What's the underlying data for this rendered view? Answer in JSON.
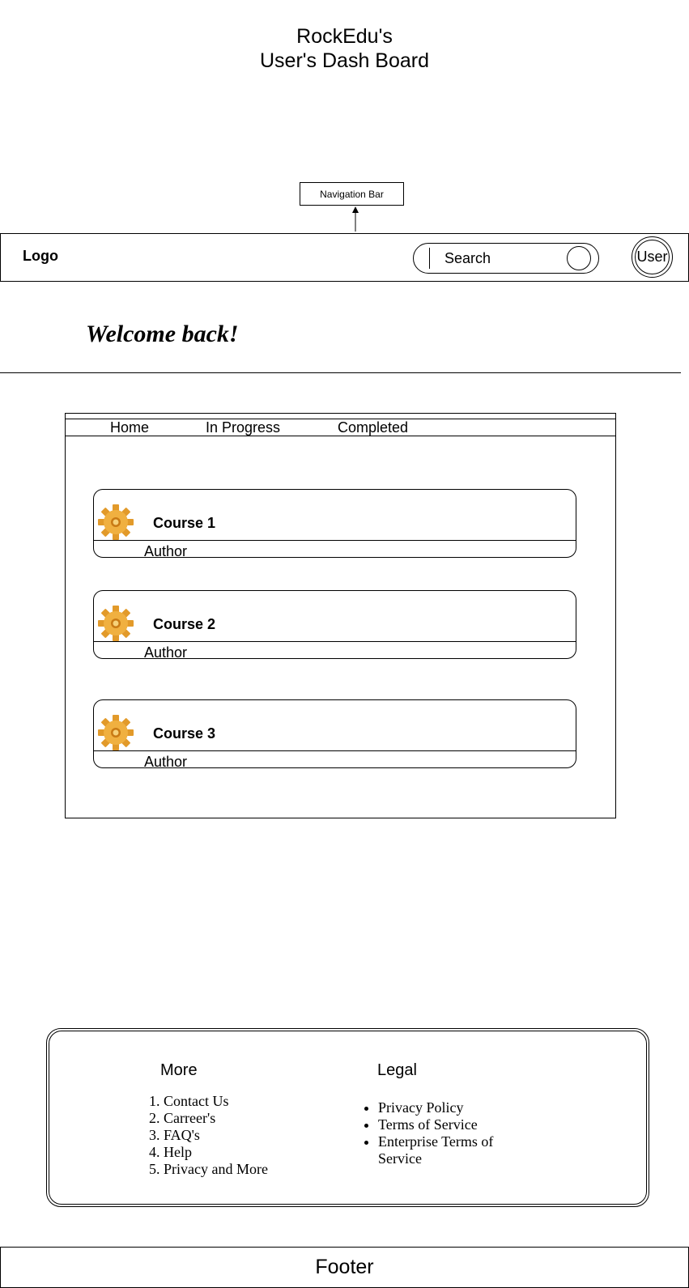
{
  "title": {
    "line1": "RockEdu's",
    "line2": "User's Dash Board"
  },
  "annotation": {
    "nav_bar": "Navigation Bar"
  },
  "header": {
    "logo": "Logo",
    "search_placeholder": "Search",
    "user": "User"
  },
  "welcome": "Welcome back!",
  "tabs": [
    "Home",
    "In Progress",
    "Completed"
  ],
  "courses": [
    {
      "title": "Course 1",
      "author": "Author",
      "icon": "gear-icon"
    },
    {
      "title": "Course 2",
      "author": "Author",
      "icon": "gear-icon"
    },
    {
      "title": "Course 3",
      "author": "Author",
      "icon": "gear-icon"
    }
  ],
  "footer_panel": {
    "more": {
      "heading": "More",
      "items": [
        "Contact Us",
        "Carreer's",
        "FAQ's",
        "Help",
        "Privacy and More"
      ]
    },
    "legal": {
      "heading": "Legal",
      "items": [
        "Privacy Policy",
        "Terms of Service",
        "Enterprise Terms of Service"
      ]
    }
  },
  "footer": "Footer",
  "colors": {
    "gear": "#f0b040",
    "gear_dark": "#c97a14"
  }
}
